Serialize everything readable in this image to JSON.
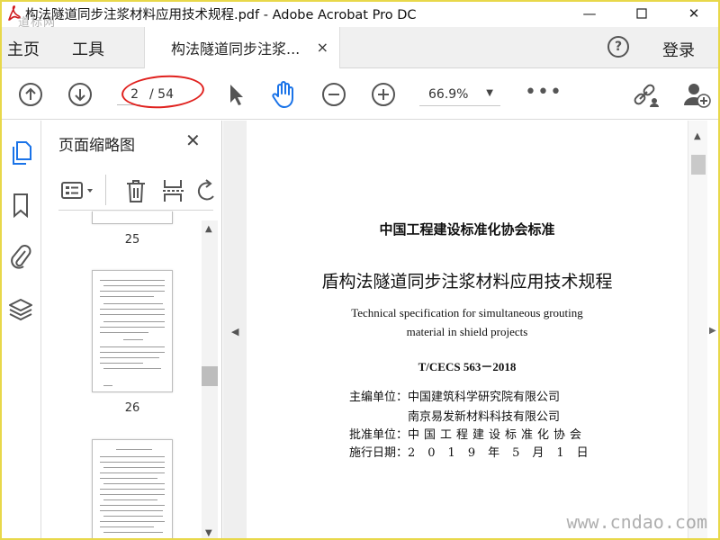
{
  "window": {
    "title": "构法隧道同步注浆材料应用技术规程.pdf - Adobe Acrobat Pro DC",
    "watermark_top_left": "道标网",
    "min_symbol": "—",
    "max_symbol": "☐",
    "close_symbol": "✕"
  },
  "tabs": {
    "home": "主页",
    "tools": "工具",
    "document": "构法隧道同步注浆...",
    "close_symbol": "×",
    "help_symbol": "?",
    "login": "登录"
  },
  "toolbar": {
    "current_page": "2",
    "total_pages": "/ 54",
    "zoom": "66.9%",
    "zoom_caret": "▼",
    "more": "•••"
  },
  "thumbnail_panel": {
    "title": "页面缩略图",
    "close_symbol": "✕",
    "thumbnails": [
      {
        "label": "25"
      },
      {
        "label": "26"
      }
    ]
  },
  "document": {
    "header": "中国工程建设标准化协会标准",
    "title_zh": "盾构法隧道同步注浆材料应用技术规程",
    "title_en_line1": "Technical specification for simultaneous grouting",
    "title_en_line2": "material in shield projects",
    "code": "T/CECS 563－2018",
    "editor_label": "主编单位：",
    "editor_1": "中国建筑科学研究院有限公司",
    "editor_2": "南京易发新材料科技有限公司",
    "approver_label": "批准单位：",
    "approver": "中国工程建设标准化协会",
    "date_label": "施行日期：",
    "date": "2019年5月1日"
  },
  "watermark_bottom_right": "www.cndao.com",
  "colors": {
    "accent_blue": "#1a73e8",
    "annotation_red": "#e0211e",
    "frame_yellow": "#e8d84a"
  },
  "icons": [
    "pdf-app-icon",
    "prev-page-icon",
    "next-page-icon",
    "select-cursor-icon",
    "hand-tool-icon",
    "zoom-out-icon",
    "zoom-in-icon",
    "share-link-icon",
    "add-user-icon",
    "page-thumbnails-icon",
    "bookmark-icon",
    "attachment-icon",
    "layers-icon",
    "thumbnail-options-icon",
    "delete-icon",
    "extract-icon",
    "rotate-icon"
  ]
}
